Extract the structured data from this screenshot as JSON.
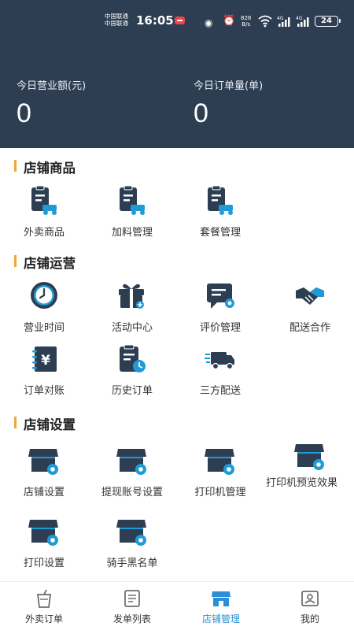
{
  "status_bar": {
    "carrier1": "中国联通",
    "carrier2": "中国联通",
    "time": "16:05",
    "net_speed_value": "828",
    "net_speed_unit": "B/s",
    "signal1_label": "4G",
    "signal2_label": "4G",
    "battery": "24"
  },
  "stats": {
    "revenue_label": "今日营业额(元)",
    "revenue_value": "0",
    "orders_label": "今日订单量(单)",
    "orders_value": "0"
  },
  "sections": {
    "goods": {
      "title": "店铺商品",
      "items": [
        "外卖商品",
        "加料管理",
        "套餐管理"
      ]
    },
    "operations": {
      "title": "店铺运营",
      "items": [
        "营业时间",
        "活动中心",
        "评价管理",
        "配送合作",
        "订单对账",
        "历史订单",
        "三方配送"
      ]
    },
    "settings": {
      "title": "店铺设置",
      "items": [
        "店铺设置",
        "提现账号设置",
        "打印机管理",
        "打印机预览效果",
        "打印设置",
        "骑手黑名单"
      ]
    }
  },
  "tabs": [
    "外卖订单",
    "发单列表",
    "店铺管理",
    "我的"
  ],
  "active_tab": "店铺管理",
  "colors": {
    "header_bg": "#2e3e52",
    "icon_dark": "#2e3e52",
    "icon_accent": "#1e9bd7",
    "section_bar": "#f0a43a",
    "active_tab": "#2a8fd6"
  }
}
